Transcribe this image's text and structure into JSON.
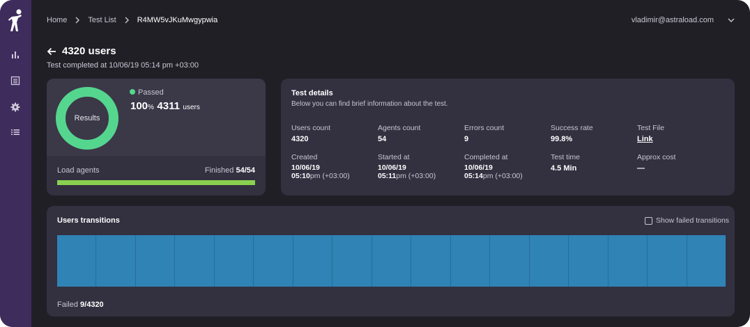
{
  "breadcrumb": {
    "home": "Home",
    "list": "Test List",
    "current": "R4MW5vJKuMwgypwia"
  },
  "user": {
    "email": "vladimir@astraload.com"
  },
  "page": {
    "title": "4320 users",
    "subtitle": "Test completed at 10/06/19 05:14 pm +03:00"
  },
  "summary": {
    "donut_label": "Results",
    "status": "Passed",
    "status_color": "#55d68e",
    "percent_value": "100",
    "percent_sign": "%",
    "users_value": "4311",
    "users_unit": "users",
    "load_label": "Load agents",
    "finished_label": "Finished",
    "finished_value": "54/54",
    "load_progress": 1.0,
    "progress_color": "#8ad14f"
  },
  "details": {
    "title": "Test details",
    "description": "Below you can find brief information about the test.",
    "users_count_label": "Users count",
    "users_count_value": "4320",
    "agents_count_label": "Agents count",
    "agents_count_value": "54",
    "errors_count_label": "Errors count",
    "errors_count_value": "9",
    "success_rate_label": "Success rate",
    "success_rate_value": "99.8%",
    "test_file_label": "Test File",
    "test_file_value": "Link",
    "created_label": "Created",
    "created_date": "10/06/19",
    "created_time": "05:10",
    "created_suffix": "pm (+03:00)",
    "started_label": "Started at",
    "started_date": "10/06/19",
    "started_time": "05:11",
    "started_suffix": "pm (+03:00)",
    "completed_label": "Completed at",
    "completed_date": "10/06/19",
    "completed_time": "05:14",
    "completed_suffix": "pm (+03:00)",
    "test_time_label": "Test time",
    "test_time_value": "4.5 Min",
    "approx_cost_label": "Approx cost",
    "approx_cost_value": "—"
  },
  "transitions": {
    "title": "Users transitions",
    "show_failed_label": "Show failed transitions",
    "show_failed_checked": false,
    "segment_count": 17,
    "bar_color": "#2f83b5",
    "failed_label": "Failed",
    "failed_value": "9/4320"
  },
  "icons": {
    "logo": "figure-logo-icon",
    "nav": [
      "bar-chart-icon",
      "table-icon",
      "gear-icon",
      "list-icon"
    ],
    "back": "arrow-left-icon",
    "breadcrumb_sep": "chevron-right-icon",
    "user_menu": "chevron-down-icon"
  },
  "colors": {
    "sidebar": "#3e2c5c",
    "background": "#211f26",
    "card": "#333040"
  }
}
